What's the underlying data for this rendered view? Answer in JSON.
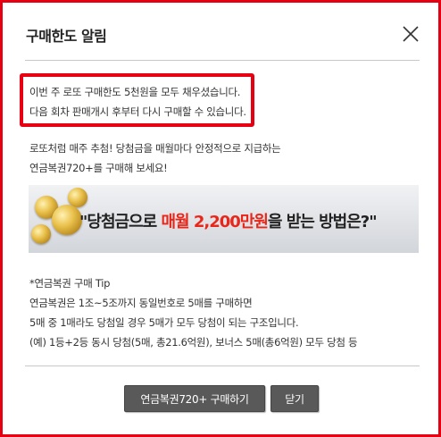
{
  "dialog": {
    "title": "구매한도 알림",
    "close_icon": "close-x-icon"
  },
  "notice": {
    "line1": "이번 주 로또 구매한도 5천원을 모두 채우셨습니다.",
    "line2": "다음 회차 판매개시 후부터 다시 구매할 수 있습니다.",
    "highlight_color": "#e60012"
  },
  "promo": {
    "line1": "로또처럼 매주 추첨! 당첨금을 매월마다 안정적으로 지급하는",
    "line2": "연금복권720+를 구매해 보세요!"
  },
  "banner": {
    "text_before": "\"당첨금으로 ",
    "text_highlight": "매월 2,200만원",
    "text_after": "을 받는 방법은?\"",
    "highlight_color": "#e8271a",
    "image_icon": "gold-coins-icon"
  },
  "tip": {
    "title": "*연금복권 구매 Tip",
    "line1": "연금복권은 1조~5조까지 동일번호로 5매를 구매하면",
    "line2": "5매 중 1매라도 당첨일 경우 5매가 모두 당첨이 되는 구조입니다.",
    "line3": "(예) 1등+2등 동시 당첨(5매, 총21.6억원), 보너스 5매(총6억원) 모두 당첨 등"
  },
  "buttons": {
    "buy_label": "연금복권720+ 구매하기",
    "close_label": "닫기"
  }
}
